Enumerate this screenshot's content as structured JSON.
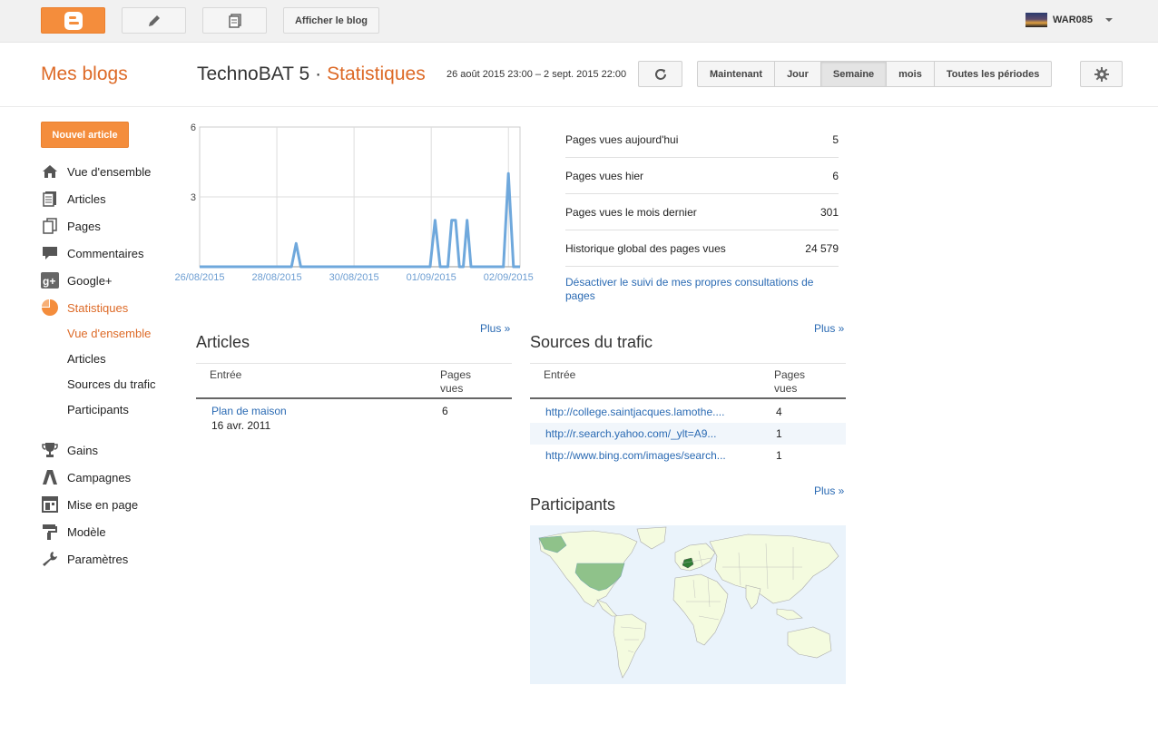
{
  "topbar": {
    "view_blog_label": "Afficher le blog",
    "user_name": "WAR085"
  },
  "header": {
    "my_blogs": "Mes blogs",
    "blog_name": "TechnoBAT 5",
    "separator": "·",
    "section": "Statistiques",
    "date_range": "26 août 2015 23:00 – 2 sept. 2015 22:00",
    "periods": [
      "Maintenant",
      "Jour",
      "Semaine",
      "mois",
      "Toutes les périodes"
    ],
    "active_period": "Semaine"
  },
  "sidebar": {
    "new_post": "Nouvel article",
    "items": [
      {
        "label": "Vue d'ensemble",
        "icon": "home-icon"
      },
      {
        "label": "Articles",
        "icon": "posts-icon"
      },
      {
        "label": "Pages",
        "icon": "pages-icon"
      },
      {
        "label": "Commentaires",
        "icon": "comment-icon"
      },
      {
        "label": "Google+",
        "icon": "google-plus-icon"
      },
      {
        "label": "Statistiques",
        "icon": "pie-chart-icon"
      }
    ],
    "sub_items": [
      {
        "label": "Vue d'ensemble"
      },
      {
        "label": "Articles"
      },
      {
        "label": "Sources du trafic"
      },
      {
        "label": "Participants"
      }
    ],
    "items2": [
      {
        "label": "Gains",
        "icon": "trophy-icon"
      },
      {
        "label": "Campagnes",
        "icon": "campaign-icon"
      },
      {
        "label": "Mise en page",
        "icon": "layout-icon"
      },
      {
        "label": "Modèle",
        "icon": "paint-roller-icon"
      },
      {
        "label": "Paramètres",
        "icon": "wrench-icon"
      }
    ]
  },
  "chart_data": {
    "type": "line",
    "x_ticks": [
      "26/08/2015",
      "28/08/2015",
      "30/08/2015",
      "01/09/2015",
      "02/09/2015"
    ],
    "y_ticks": [
      "6",
      "3"
    ],
    "ylim": [
      0,
      6
    ],
    "series": [
      {
        "values": [
          [
            0,
            0
          ],
          [
            2.38,
            0
          ],
          [
            2.5,
            1
          ],
          [
            2.62,
            0
          ],
          [
            5.97,
            0
          ],
          [
            6.1,
            2
          ],
          [
            6.23,
            0
          ],
          [
            6.43,
            0
          ],
          [
            6.53,
            2
          ],
          [
            6.63,
            2
          ],
          [
            6.73,
            0
          ],
          [
            6.83,
            0
          ],
          [
            6.93,
            2
          ],
          [
            7.03,
            0
          ],
          [
            7.87,
            0
          ],
          [
            8.0,
            4
          ],
          [
            8.13,
            0
          ],
          [
            8.3,
            0
          ]
        ]
      }
    ],
    "color": "#6fa8dc"
  },
  "stats": {
    "rows": [
      {
        "label": "Pages vues aujourd'hui",
        "value": "5"
      },
      {
        "label": "Pages vues hier",
        "value": "6"
      },
      {
        "label": "Pages vues le mois dernier",
        "value": "301"
      },
      {
        "label": "Historique global des pages vues",
        "value": "24 579"
      }
    ],
    "disable_link": "Désactiver le suivi de mes propres consultations de pages"
  },
  "articles": {
    "more": "Plus »",
    "title": "Articles",
    "col1": "Entrée",
    "col2": "Pages vues",
    "rows": [
      {
        "title": "Plan de maison",
        "date": "16 avr. 2011",
        "views": "6"
      }
    ]
  },
  "traffic": {
    "more": "Plus »",
    "title": "Sources du trafic",
    "col1": "Entrée",
    "col2": "Pages vues",
    "rows": [
      {
        "url": "http://college.saintjacques.lamothe....",
        "views": "4"
      },
      {
        "url": "http://r.search.yahoo.com/_ylt=A9...",
        "views": "1"
      },
      {
        "url": "http://www.bing.com/images/search...",
        "views": "1"
      }
    ]
  },
  "audience": {
    "more": "Plus »",
    "title": "Participants"
  }
}
